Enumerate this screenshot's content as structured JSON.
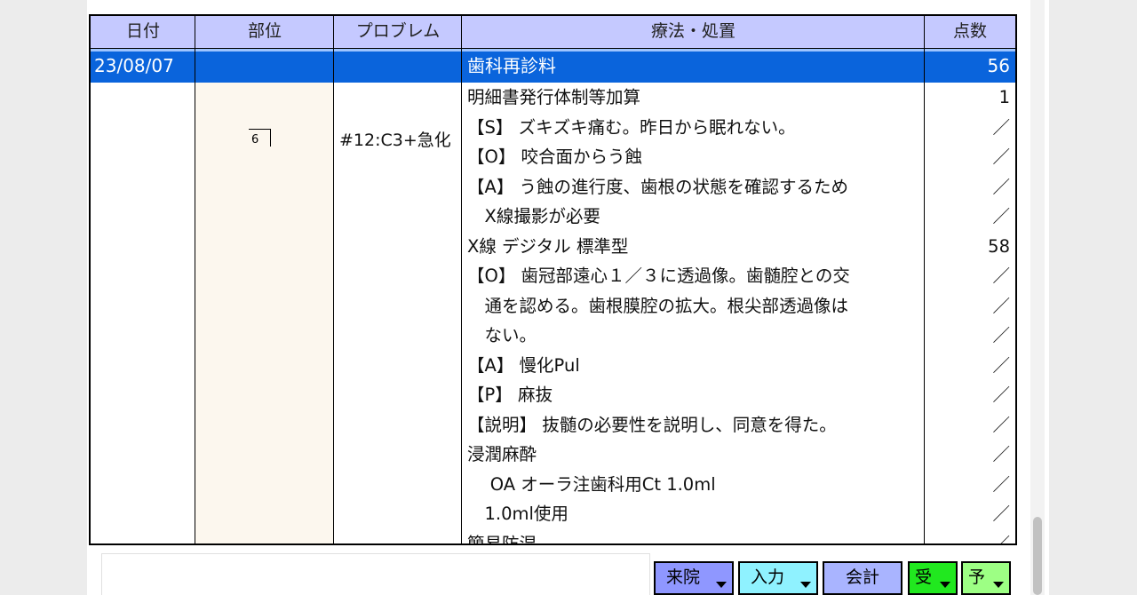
{
  "header": {
    "date": "日付",
    "site": "部位",
    "problem": "プロブレム",
    "treatment": "療法・処置",
    "points": "点数"
  },
  "selected_row": {
    "date": "23/08/07",
    "treatment": "歯科再診料",
    "points": "56"
  },
  "tooth_chart": {
    "tooth": "6"
  },
  "problem_text": "#12:C3+急化",
  "rows": [
    {
      "text": "明細書発行体制等加算",
      "points": "1"
    },
    {
      "text": "【S】 ズキズキ痛む。昨日から眠れない。",
      "points": "／"
    },
    {
      "text": "【O】 咬合面からう蝕",
      "points": "／"
    },
    {
      "text": "【A】 う蝕の進行度、歯根の状態を確認するため",
      "points": "／"
    },
    {
      "text": "　X線撮影が必要",
      "points": "／"
    },
    {
      "text": "X線 デジタル 標準型",
      "points": "58"
    },
    {
      "text": "【O】 歯冠部遠心１／３に透過像。歯髄腔との交",
      "points": "／"
    },
    {
      "text": "　通を認める。歯根膜腔の拡大。根尖部透過像は",
      "points": "／"
    },
    {
      "text": "　ない。",
      "points": "／"
    },
    {
      "text": "【A】 慢化Pul",
      "points": "／"
    },
    {
      "text": "【P】 麻抜",
      "points": "／"
    },
    {
      "text": "【説明】 抜髄の必要性を説明し、同意を得た。",
      "points": "／"
    },
    {
      "text": "浸潤麻酔",
      "points": "／"
    },
    {
      "text": "　 OA オーラ注歯科用Ct 1.0ml",
      "points": "／"
    },
    {
      "text": "　1.0ml使用",
      "points": "／"
    },
    {
      "text": "簡易防湿",
      "points": "／"
    }
  ],
  "buttons": {
    "visit": "来院",
    "input": "入力",
    "billing": "会計",
    "reception": "受",
    "appointment": "予"
  },
  "colors": {
    "header_bg": "#c5c9ff",
    "selection": "#0a64dc",
    "site_column_bg": "#fcf7ee",
    "visit_btn": "#8f97ff",
    "input_btn": "#8ff2ff",
    "billing_btn": "#a9b4ff",
    "reception_btn": "#21e81f",
    "appointment_btn": "#9dff84"
  }
}
